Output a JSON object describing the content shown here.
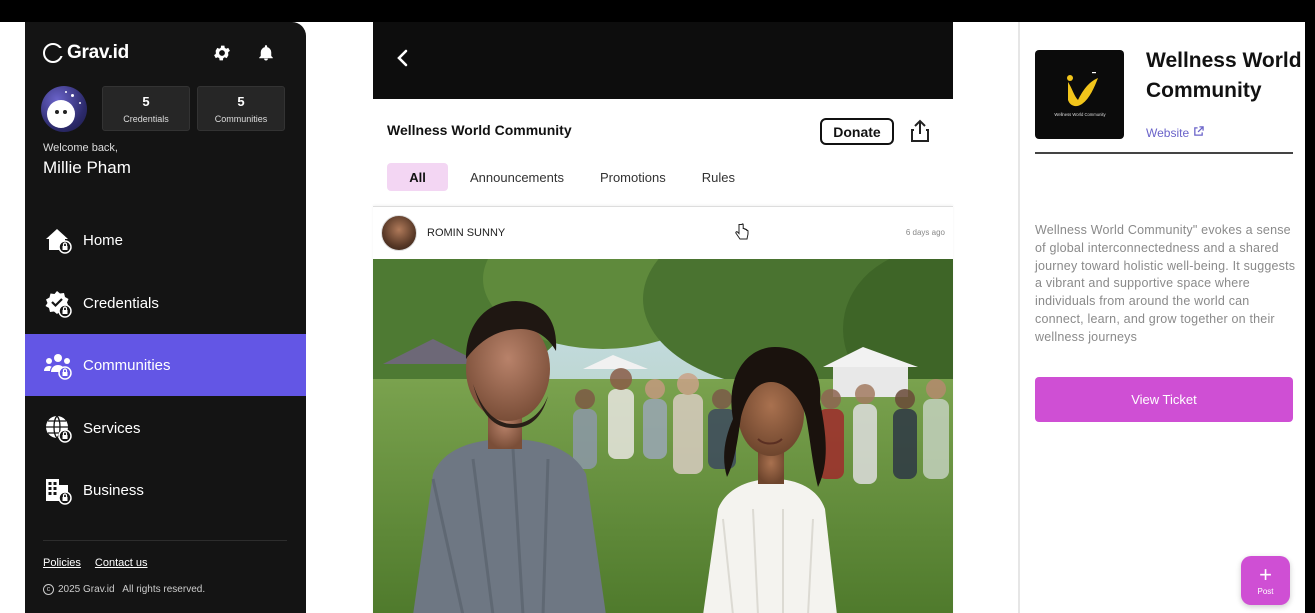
{
  "brand": {
    "name": "Grav.id"
  },
  "sidebar": {
    "stats": [
      {
        "value": "5",
        "label": "Credentials"
      },
      {
        "value": "5",
        "label": "Communities"
      }
    ],
    "welcome": "Welcome back,",
    "user_name": "Millie Pham",
    "nav": [
      {
        "label": "Home",
        "icon": "home-icon",
        "active": false
      },
      {
        "label": "Credentials",
        "icon": "credentials-icon",
        "active": false
      },
      {
        "label": "Communities",
        "icon": "communities-icon",
        "active": true
      },
      {
        "label": "Services",
        "icon": "services-icon",
        "active": false
      },
      {
        "label": "Business",
        "icon": "business-icon",
        "active": false
      }
    ],
    "footer": {
      "policies": "Policies",
      "contact": "Contact us",
      "copyright": "2025 Grav.id   All rights reserved."
    }
  },
  "community": {
    "title": "Wellness World Community",
    "donate_label": "Donate",
    "tabs": [
      "All",
      "Announcements",
      "Promotions",
      "Rules"
    ],
    "active_tab": "All"
  },
  "post": {
    "author": "ROMIN SUNNY",
    "time": "6 days ago"
  },
  "details": {
    "name": "Wellness World Community",
    "website_label": "Website",
    "description": "Wellness World Community\" evokes a sense of global interconnectedness and a shared journey toward holistic well-being. It suggests a vibrant and supportive space where individuals from around the world can connect, learn, and grow together on their wellness journeys",
    "view_ticket_label": "View Ticket"
  },
  "fab": {
    "label": "Post"
  },
  "colors": {
    "accent": "#6356e5",
    "pink": "#cf4fd4",
    "sidebar_bg": "#141414"
  }
}
